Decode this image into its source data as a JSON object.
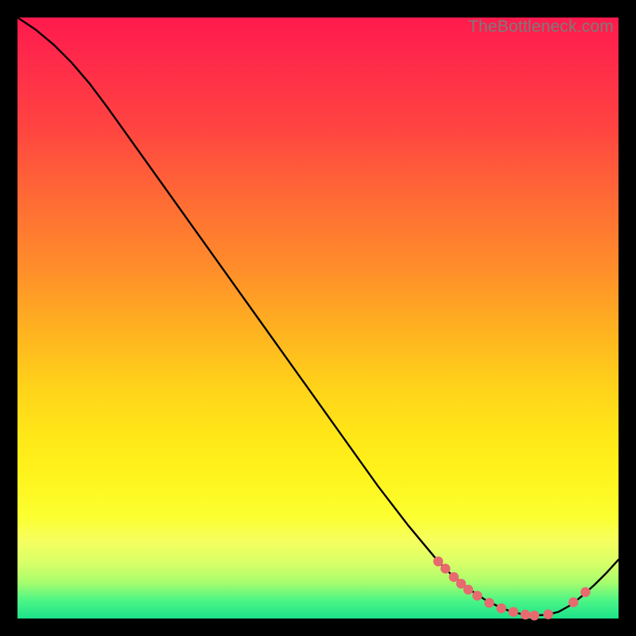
{
  "watermark": "TheBottleneck.com",
  "colors": {
    "dot": "#e76a6f",
    "curve": "#000000"
  },
  "chart_data": {
    "type": "line",
    "title": "",
    "xlabel": "",
    "ylabel": "",
    "xlim": [
      0,
      100
    ],
    "ylim": [
      0,
      100
    ],
    "grid": false,
    "legend": false,
    "series": [
      {
        "name": "curve",
        "x": [
          0,
          3,
          6,
          9,
          12,
          15,
          20,
          25,
          30,
          35,
          40,
          45,
          50,
          55,
          60,
          65,
          70,
          72,
          74,
          76,
          78,
          80,
          82,
          84,
          86,
          88,
          90,
          92,
          94,
          96,
          98,
          100
        ],
        "y": [
          100,
          98,
          95.5,
          92.5,
          89,
          85,
          78,
          71,
          64,
          57,
          50,
          43,
          36,
          29,
          22,
          15.5,
          9.5,
          7.5,
          5.8,
          4.3,
          3.0,
          2.0,
          1.2,
          0.7,
          0.5,
          0.6,
          1.1,
          2.2,
          3.8,
          5.6,
          7.6,
          9.8
        ]
      }
    ],
    "points": [
      {
        "x": 70.0,
        "y": 9.5
      },
      {
        "x": 71.2,
        "y": 8.3
      },
      {
        "x": 72.6,
        "y": 6.9
      },
      {
        "x": 73.8,
        "y": 5.8
      },
      {
        "x": 75.0,
        "y": 4.8
      },
      {
        "x": 76.5,
        "y": 3.8
      },
      {
        "x": 78.5,
        "y": 2.6
      },
      {
        "x": 80.5,
        "y": 1.7
      },
      {
        "x": 82.5,
        "y": 1.1
      },
      {
        "x": 84.5,
        "y": 0.65
      },
      {
        "x": 86.0,
        "y": 0.5
      },
      {
        "x": 88.3,
        "y": 0.7
      },
      {
        "x": 92.5,
        "y": 2.7
      },
      {
        "x": 94.5,
        "y": 4.4
      }
    ]
  }
}
